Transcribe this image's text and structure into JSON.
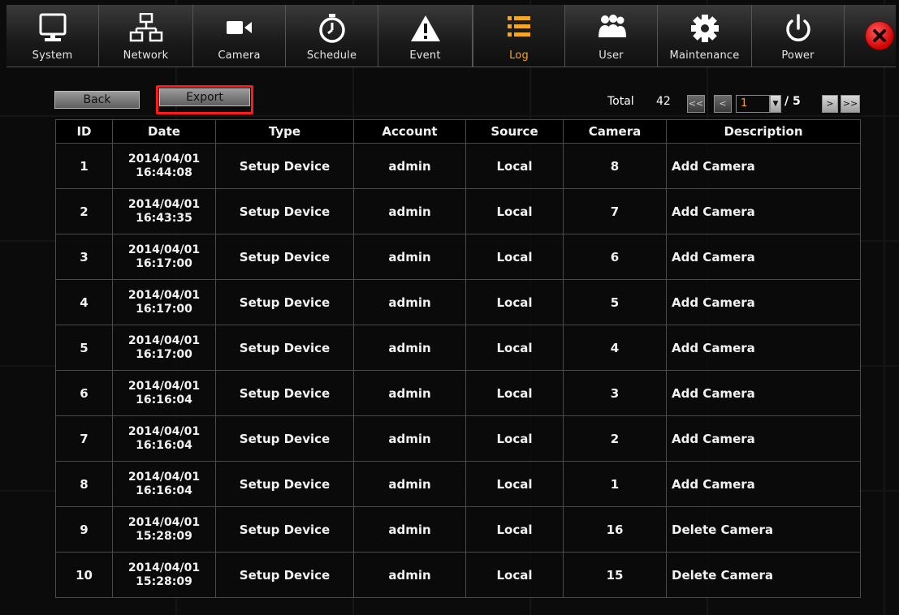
{
  "toolbar": {
    "tabs": [
      {
        "id": "system",
        "label": "System",
        "icon": "monitor-icon"
      },
      {
        "id": "network",
        "label": "Network",
        "icon": "network-icon"
      },
      {
        "id": "camera",
        "label": "Camera",
        "icon": "video-camera-icon"
      },
      {
        "id": "schedule",
        "label": "Schedule",
        "icon": "stopwatch-icon"
      },
      {
        "id": "event",
        "label": "Event",
        "icon": "warning-icon"
      },
      {
        "id": "log",
        "label": "Log",
        "icon": "list-icon",
        "active": true
      },
      {
        "id": "user",
        "label": "User",
        "icon": "users-icon"
      },
      {
        "id": "maintenance",
        "label": "Maintenance",
        "icon": "gear-icon"
      },
      {
        "id": "power",
        "label": "Power",
        "icon": "power-icon"
      }
    ],
    "close_icon": "close-icon"
  },
  "actions": {
    "back_label": "Back",
    "export_label": "Export"
  },
  "pager": {
    "total_label": "Total",
    "total": "42",
    "first": "<<",
    "prev": "<",
    "current_page": "1",
    "separator": "/ 5",
    "next": ">",
    "last": ">>"
  },
  "table": {
    "headers": {
      "id": "ID",
      "date": "Date",
      "type": "Type",
      "account": "Account",
      "source": "Source",
      "camera": "Camera",
      "description": "Description"
    },
    "rows": [
      {
        "id": "1",
        "date": "2014/04/01",
        "time": "16:44:08",
        "type": "Setup Device",
        "account": "admin",
        "source": "Local",
        "camera": "8",
        "description": "Add Camera"
      },
      {
        "id": "2",
        "date": "2014/04/01",
        "time": "16:43:35",
        "type": "Setup Device",
        "account": "admin",
        "source": "Local",
        "camera": "7",
        "description": "Add Camera"
      },
      {
        "id": "3",
        "date": "2014/04/01",
        "time": "16:17:00",
        "type": "Setup Device",
        "account": "admin",
        "source": "Local",
        "camera": "6",
        "description": "Add Camera"
      },
      {
        "id": "4",
        "date": "2014/04/01",
        "time": "16:17:00",
        "type": "Setup Device",
        "account": "admin",
        "source": "Local",
        "camera": "5",
        "description": "Add Camera"
      },
      {
        "id": "5",
        "date": "2014/04/01",
        "time": "16:17:00",
        "type": "Setup Device",
        "account": "admin",
        "source": "Local",
        "camera": "4",
        "description": "Add Camera"
      },
      {
        "id": "6",
        "date": "2014/04/01",
        "time": "16:16:04",
        "type": "Setup Device",
        "account": "admin",
        "source": "Local",
        "camera": "3",
        "description": "Add Camera"
      },
      {
        "id": "7",
        "date": "2014/04/01",
        "time": "16:16:04",
        "type": "Setup Device",
        "account": "admin",
        "source": "Local",
        "camera": "2",
        "description": "Add Camera"
      },
      {
        "id": "8",
        "date": "2014/04/01",
        "time": "16:16:04",
        "type": "Setup Device",
        "account": "admin",
        "source": "Local",
        "camera": "1",
        "description": "Add Camera"
      },
      {
        "id": "9",
        "date": "2014/04/01",
        "time": "15:28:09",
        "type": "Setup Device",
        "account": "admin",
        "source": "Local",
        "camera": "16",
        "description": "Delete Camera"
      },
      {
        "id": "10",
        "date": "2014/04/01",
        "time": "15:28:09",
        "type": "Setup Device",
        "account": "admin",
        "source": "Local",
        "camera": "15",
        "description": "Delete Camera"
      }
    ]
  },
  "colors": {
    "accent": "#f5a623",
    "highlight_frame": "#ff1a1a",
    "close": "#e00000"
  }
}
